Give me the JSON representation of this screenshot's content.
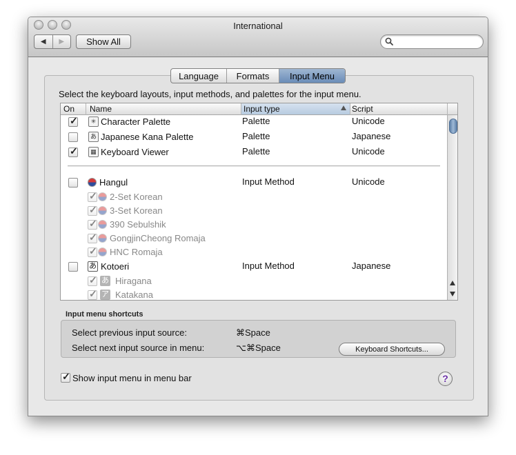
{
  "window": {
    "title": "International"
  },
  "toolbar": {
    "back_label": "◀",
    "forward_label": "▶",
    "show_all_label": "Show All",
    "search_placeholder": ""
  },
  "tabs": [
    {
      "label": "Language",
      "active": false
    },
    {
      "label": "Formats",
      "active": false
    },
    {
      "label": "Input Menu",
      "active": true
    }
  ],
  "description": "Select the keyboard layouts, input methods, and palettes for the input menu.",
  "list": {
    "columns": {
      "on": "On",
      "name": "Name",
      "input_type": "Input type",
      "script": "Script"
    },
    "rows": [
      {
        "checked": true,
        "icon": "character-palette-icon",
        "icon_glyph": "✳",
        "name": "Character Palette",
        "type": "Palette",
        "script": "Unicode"
      },
      {
        "checked": false,
        "icon": "kana-palette-icon",
        "icon_glyph": "あ",
        "name": "Japanese Kana Palette",
        "type": "Palette",
        "script": "Japanese"
      },
      {
        "checked": true,
        "icon": "keyboard-viewer-icon",
        "icon_glyph": "▦",
        "name": "Keyboard Viewer",
        "type": "Palette",
        "script": "Unicode"
      },
      {
        "checked": false,
        "icon": "korean-flag-icon",
        "name": "Hangul",
        "type": "Input Method",
        "script": "Unicode"
      },
      {
        "checked": true,
        "sub": true,
        "icon": "korean-flag-icon",
        "icon_sub": "2",
        "name": "2-Set Korean",
        "type": "",
        "script": ""
      },
      {
        "checked": true,
        "sub": true,
        "icon": "korean-flag-icon",
        "icon_sub": "3",
        "name": "3-Set Korean",
        "type": "",
        "script": ""
      },
      {
        "checked": true,
        "sub": true,
        "icon": "korean-flag-icon",
        "icon_sub": "3",
        "name": "390 Sebulshik",
        "type": "",
        "script": ""
      },
      {
        "checked": true,
        "sub": true,
        "icon": "korean-flag-icon",
        "icon_sub": "R",
        "name": "GongjinCheong Romaja",
        "type": "",
        "script": ""
      },
      {
        "checked": true,
        "sub": true,
        "icon": "korean-flag-icon",
        "icon_sub": "R",
        "name": "HNC Romaja",
        "type": "",
        "script": ""
      },
      {
        "checked": false,
        "icon": "kotoeri-icon",
        "icon_glyph": "あ",
        "name": "Kotoeri",
        "type": "Input Method",
        "script": "Japanese"
      },
      {
        "checked": true,
        "sub": true,
        "icon": "hiragana-icon",
        "icon_glyph": "あ",
        "name": "Hiragana",
        "type": "",
        "script": ""
      },
      {
        "checked": true,
        "sub": true,
        "icon": "katakana-icon",
        "icon_glyph": "ア",
        "name": "Katakana",
        "type": "",
        "script": ""
      }
    ]
  },
  "shortcuts": {
    "section_label": "Input menu shortcuts",
    "previous_label": "Select previous input source:",
    "previous_key": "⌘Space",
    "next_label": "Select next input source in menu:",
    "next_key": "⌥⌘Space",
    "keyboard_shortcuts_button": "Keyboard Shortcuts..."
  },
  "footer": {
    "show_menu_label": "Show input menu in menu bar",
    "show_menu_checked": true,
    "help_label": "?"
  },
  "check_glyph": "✓"
}
